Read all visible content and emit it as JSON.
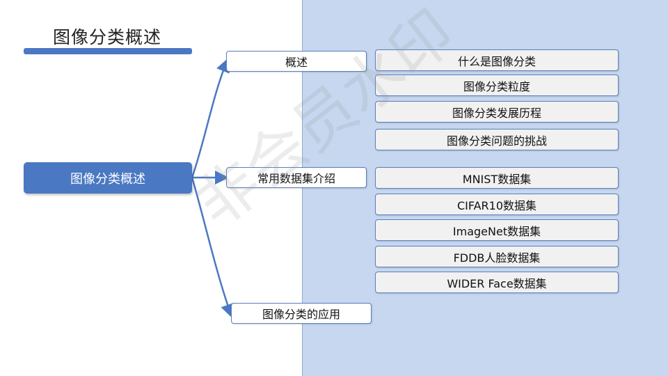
{
  "slide": {
    "title": "图像分类概述",
    "watermark": "非会员水印"
  },
  "mindmap": {
    "root": "图像分类概述",
    "branches": [
      {
        "label": "概述",
        "children": [
          "什么是图像分类",
          "图像分类粒度",
          "图像分类发展历程",
          "图像分类问题的挑战"
        ]
      },
      {
        "label": "常用数据集介绍",
        "children": [
          "MNIST数据集",
          "CIFAR10数据集",
          "ImageNet数据集",
          "FDDB人脸数据集",
          "WIDER Face数据集"
        ]
      },
      {
        "label": "图像分类的应用",
        "children": []
      }
    ]
  },
  "colors": {
    "accent": "#4a78c2",
    "panel": "#c6d7ef",
    "leaf_bg": "#f1f1f1"
  }
}
